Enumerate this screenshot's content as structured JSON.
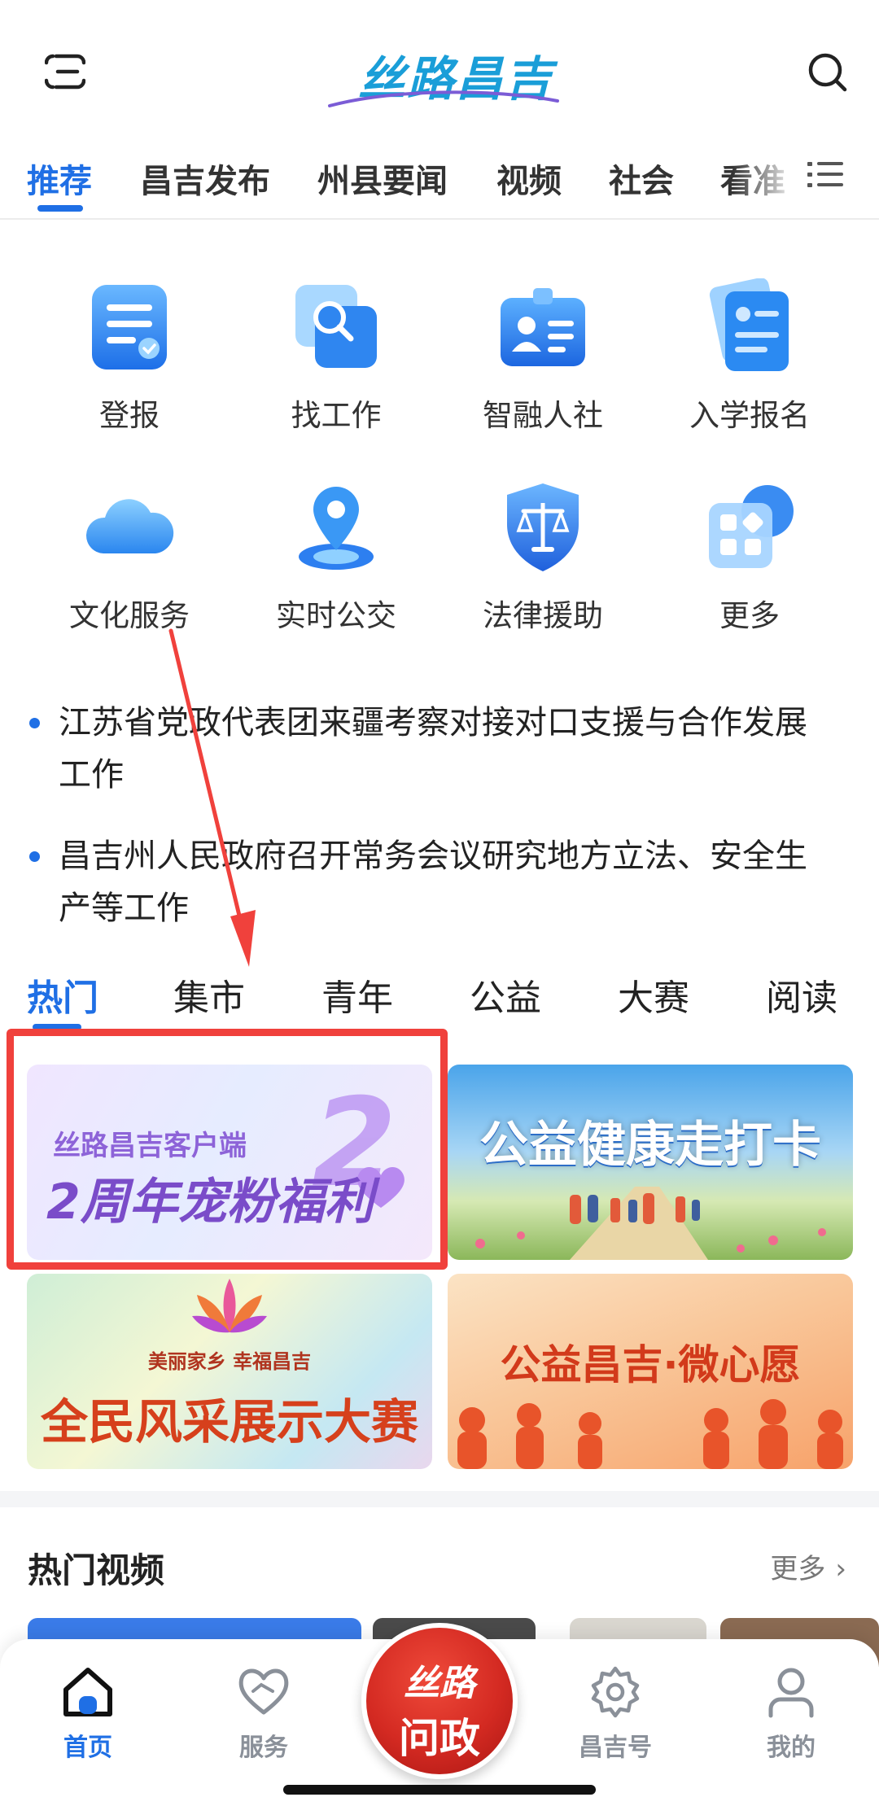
{
  "header": {
    "logo_text": "丝路昌吉"
  },
  "channels": [
    "推荐",
    "昌吉发布",
    "州县要闻",
    "视频",
    "社会",
    "看准"
  ],
  "services": [
    {
      "label": "登报",
      "icon": "newspaper-icon"
    },
    {
      "label": "找工作",
      "icon": "job-search-icon"
    },
    {
      "label": "智融人社",
      "icon": "id-card-icon"
    },
    {
      "label": "入学报名",
      "icon": "enrollment-icon"
    },
    {
      "label": "文化服务",
      "icon": "cloud-icon"
    },
    {
      "label": "实时公交",
      "icon": "location-pin-icon"
    },
    {
      "label": "法律援助",
      "icon": "scales-shield-icon"
    },
    {
      "label": "更多",
      "icon": "more-grid-icon"
    }
  ],
  "news": [
    {
      "line1": "江苏省党政代表团来疆考察对接对口支援与合作发展",
      "line2": "工作"
    },
    {
      "line1": "昌吉州人民政府召开常务会议研究地方立法、安全生",
      "line2": "产等工作"
    }
  ],
  "sub_tabs": [
    "热门",
    "集市",
    "青年",
    "公益",
    "大赛",
    "阅读"
  ],
  "banners": {
    "b1_small": "丝路昌吉客户端",
    "b1_big": "2周年宠粉福利",
    "b1_number": "2",
    "b2_title": "公益健康走打卡",
    "b3_sub": "美丽家乡  幸福昌吉",
    "b3_title": "全民风采展示大赛",
    "b4_title": "公益昌吉·微心愿"
  },
  "hot_videos": {
    "title": "热门视频",
    "more": "更多",
    "more_chevron": "›"
  },
  "bottom_nav": {
    "home": "首页",
    "service": "服务",
    "center_line1": "丝路",
    "center_line2": "问政",
    "changji_hao": "昌吉号",
    "mine": "我的"
  },
  "colors": {
    "accent": "#1f6fe5",
    "annotation": "#f0413c",
    "center_button": "#d42a22"
  }
}
